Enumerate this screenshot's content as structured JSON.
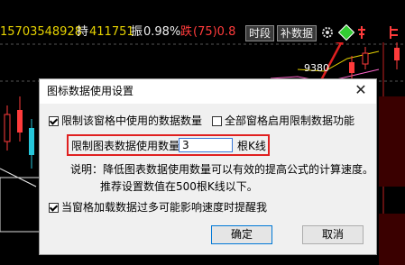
{
  "topbar": {
    "code_value": "15703548928",
    "hold_label": "持",
    "hold_value": "411751",
    "amplitude_label": "振",
    "amplitude_value": "0.98%",
    "fall_label": "跌",
    "fall_value": "(75)0.8",
    "time_button": "时段",
    "supplement_button": "补数据",
    "colors": {
      "yellow": "#e6d200",
      "red": "#ff3b3b",
      "green": "#33cc33"
    }
  },
  "chart": {
    "price_label": "9380"
  },
  "dialog": {
    "title": "图标数据使用设置",
    "limit_window_label": "限制该窗格中使用的数据数量",
    "limit_window_checked": true,
    "all_windows_label": "全部窗格启用限制数据功能",
    "all_windows_checked": false,
    "limit_count_label": "限制图表数据使用数量",
    "limit_count_value": "3",
    "limit_count_unit": "根K线",
    "note_line1": "说明：降低图表数据使用数量可以有效的提高公式的计算速度。",
    "note_line2": "推荐设置数值在500根K线以下。",
    "warn_label": "当窗格加载数据过多可能影响速度时提醒我",
    "warn_checked": true,
    "ok_label": "确定",
    "cancel_label": "取消"
  }
}
